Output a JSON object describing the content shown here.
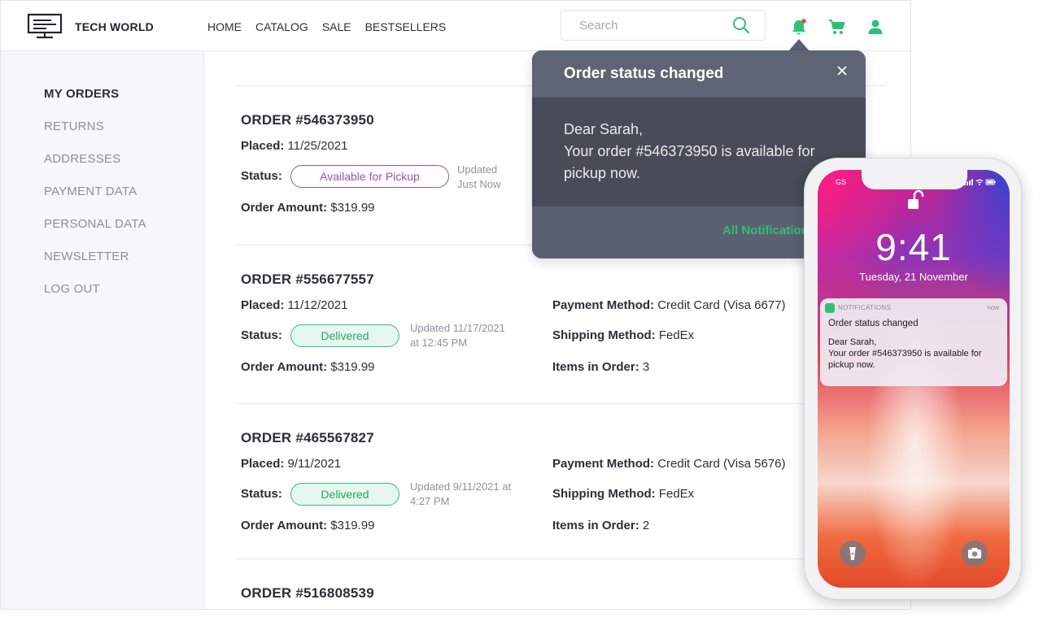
{
  "header": {
    "brand": "TECH WORLD",
    "nav": [
      "HOME",
      "CATALOG",
      "SALE",
      "BESTSELLERS"
    ],
    "search_placeholder": "Search",
    "accent_color": "#2fbf7a"
  },
  "sidebar": {
    "items": [
      {
        "label": "MY ORDERS",
        "active": true
      },
      {
        "label": "RETURNS"
      },
      {
        "label": "ADDRESSES"
      },
      {
        "label": "PAYMENT DATA"
      },
      {
        "label": "PERSONAL DATA"
      },
      {
        "label": "NEWSLETTER"
      },
      {
        "label": "LOG OUT"
      }
    ]
  },
  "labels": {
    "placed": "Placed:",
    "status": "Status:",
    "order_amount": "Order Amount:",
    "payment_method": "Payment Method:",
    "shipping_method": "Shipping Method:",
    "items_in_order": "Items in Order:"
  },
  "orders": [
    {
      "title": "ORDER #546373950",
      "placed": "11/25/2021",
      "status": "Available for Pickup",
      "updated_line1": "Updated",
      "updated_line2": "Just Now",
      "amount": "$319.99"
    },
    {
      "title": "ORDER #556677557",
      "placed": "11/12/2021",
      "status": "Delivered",
      "updated_line1": "Updated 11/17/2021",
      "updated_line2": "at 12:45 PM",
      "amount": "$319.99",
      "payment": "Credit Card (Visa 6677)",
      "shipping": "FedEx",
      "items": "3"
    },
    {
      "title": "ORDER #465567827",
      "placed": "9/11/2021",
      "status": "Delivered",
      "updated_line1": "Updated 9/11/2021 at",
      "updated_line2": "4:27 PM",
      "amount": "$319.99",
      "payment": "Credit Card (Visa 5676)",
      "shipping": "FedEx",
      "items": "2"
    },
    {
      "title": "ORDER #516808539"
    }
  ],
  "popup": {
    "title": "Order status changed",
    "greeting": "Dear Sarah,",
    "message": "Your order #546373950 is available for pickup now.",
    "link": "All Notifications"
  },
  "phone": {
    "carrier": "GS",
    "time": "9:41",
    "date": "Tuesday, 21 November",
    "notification": {
      "app": "NOTIFICATIONS",
      "when": "now",
      "title": "Order status changed",
      "greeting": "Dear Sarah,",
      "message": "Your order #546373950 is available for pickup now."
    }
  }
}
